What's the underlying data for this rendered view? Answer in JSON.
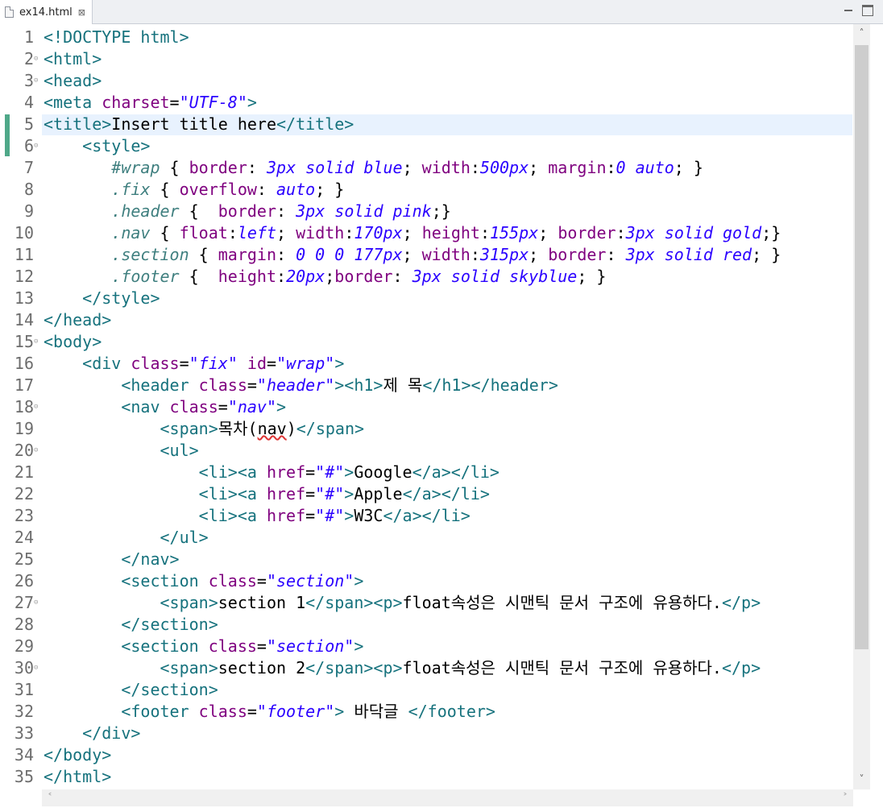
{
  "tab": {
    "title": "ex14.html",
    "close": "⊠"
  },
  "editor": {
    "line_numbers": [
      "1",
      "2",
      "3",
      "4",
      "5",
      "6",
      "7",
      "8",
      "9",
      "10",
      "11",
      "12",
      "13",
      "14",
      "15",
      "16",
      "17",
      "18",
      "19",
      "20",
      "21",
      "22",
      "23",
      "24",
      "25",
      "26",
      "27",
      "28",
      "29",
      "30",
      "31",
      "32",
      "33",
      "34",
      "35"
    ],
    "fold_marker": "⊝",
    "lines": {
      "l1": [
        "<!DOCTYPE html>"
      ],
      "l2": [
        "<html>"
      ],
      "l3": [
        "<head>"
      ],
      "l4": [
        "<meta ",
        "charset",
        "=",
        "\"UTF-8\"",
        ">"
      ],
      "l5": [
        "<title>",
        "Insert title here",
        "</title>"
      ],
      "l6": [
        "    ",
        "<style>"
      ],
      "l7": [
        "       ",
        "#wrap",
        " { ",
        "border",
        ": ",
        "3px solid blue",
        "; ",
        "width",
        ":",
        "500px",
        "; ",
        "margin",
        ":",
        "0 auto",
        "; }"
      ],
      "l8": [
        "       ",
        ".fix",
        " { ",
        "overflow",
        ": ",
        "auto",
        "; }"
      ],
      "l9": [
        "       ",
        ".header",
        " {  ",
        "border",
        ": ",
        "3px solid pink",
        ";}"
      ],
      "l10": [
        "       ",
        ".nav",
        " { ",
        "float",
        ":",
        "left",
        "; ",
        "width",
        ":",
        "170px",
        "; ",
        "height",
        ":",
        "155px",
        "; ",
        "border",
        ":",
        "3px solid gold",
        ";}"
      ],
      "l11": [
        "       ",
        ".section",
        " { ",
        "margin",
        ": ",
        "0 0 0 177px",
        "; ",
        "width",
        ":",
        "315px",
        "; ",
        "border",
        ": ",
        "3px solid red",
        "; }"
      ],
      "l12": [
        "       ",
        ".footer",
        " {  ",
        "height",
        ":",
        "20px",
        ";",
        "border",
        ": ",
        "3px solid skyblue",
        "; }"
      ],
      "l13": [
        "    ",
        "</style>"
      ],
      "l14": [
        "</head>"
      ],
      "l15": [
        "<body>"
      ],
      "l16": [
        "    ",
        "<div ",
        "class",
        "=",
        "\"fix\"",
        " ",
        "id",
        "=",
        "\"wrap\"",
        ">"
      ],
      "l17": [
        "        ",
        "<header ",
        "class",
        "=",
        "\"header\"",
        "><h1>",
        "제 목",
        "</h1></header>"
      ],
      "l18": [
        "        ",
        "<nav ",
        "class",
        "=",
        "\"nav\"",
        ">"
      ],
      "l19": [
        "            ",
        "<span>",
        "목차(",
        "nav",
        ")",
        "</span>"
      ],
      "l20": [
        "            ",
        "<ul>"
      ],
      "l21": [
        "                ",
        "<li><a ",
        "href",
        "=",
        "\"#\"",
        ">",
        "Google",
        "</a></li>"
      ],
      "l22": [
        "                ",
        "<li><a ",
        "href",
        "=",
        "\"#\"",
        ">",
        "Apple",
        "</a></li>"
      ],
      "l23": [
        "                ",
        "<li><a ",
        "href",
        "=",
        "\"#\"",
        ">",
        "W3C",
        "</a></li>"
      ],
      "l24": [
        "            ",
        "</ul>"
      ],
      "l25": [
        "        ",
        "</nav>"
      ],
      "l26": [
        "        ",
        "<section ",
        "class",
        "=",
        "\"section\"",
        ">"
      ],
      "l27": [
        "            ",
        "<span>",
        "section 1",
        "</span><p>",
        "float속성은 시맨틱 문서 구조에 유용하다.",
        "</p>"
      ],
      "l28": [
        "        ",
        "</section>"
      ],
      "l29": [
        "        ",
        "<section ",
        "class",
        "=",
        "\"section\"",
        ">"
      ],
      "l30": [
        "            ",
        "<span>",
        "section 2",
        "</span><p>",
        "float속성은 시맨틱 문서 구조에 유용하다.",
        "</p>"
      ],
      "l31": [
        "        ",
        "</section>"
      ],
      "l32": [
        "        ",
        "<footer ",
        "class",
        "=",
        "\"footer\"",
        ">",
        " 바닥글 ",
        "</footer>"
      ],
      "l33": [
        "    ",
        "</div>"
      ],
      "l34": [
        "</body>"
      ],
      "l35": [
        "</html>"
      ]
    }
  },
  "scrollbars": {
    "up": "˄",
    "down": "˅",
    "left": "˂",
    "right": "˃"
  },
  "colors": {
    "tag": "#16727d",
    "attr_name": "#7f007f",
    "attr_value": "#2a00ff",
    "css_selector": "#3f7f7f",
    "current_line": "#e8f2fe",
    "change_marker": "#4fa889"
  }
}
